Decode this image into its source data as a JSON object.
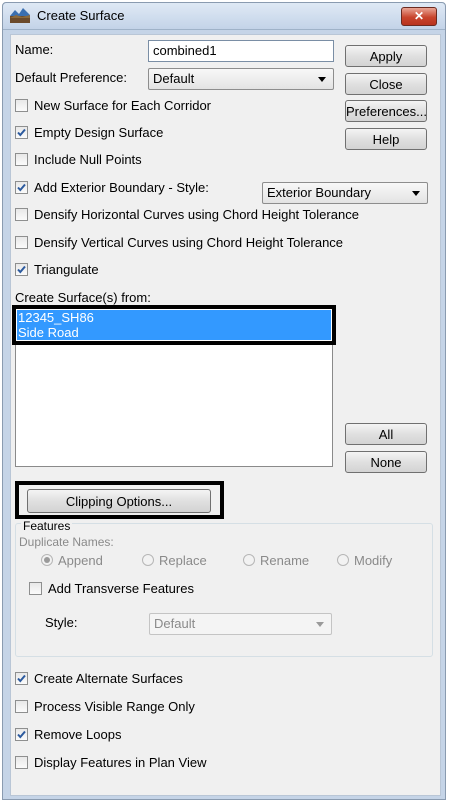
{
  "window": {
    "title": "Create Surface",
    "close_symbol": "✕"
  },
  "form": {
    "name_label": "Name:",
    "name_value": "combined1",
    "pref_label": "Default Preference:",
    "pref_value": "Default"
  },
  "buttons": {
    "apply": "Apply",
    "close": "Close",
    "preferences": "Preferences...",
    "help": "Help",
    "all": "All",
    "none": "None",
    "clipping": "Clipping Options..."
  },
  "options": {
    "new_surface": {
      "label": "New Surface for Each Corridor",
      "checked": false
    },
    "empty_design": {
      "label": "Empty Design Surface",
      "checked": true
    },
    "null_points": {
      "label": "Include Null Points",
      "checked": false
    },
    "exterior_boundary": {
      "label": "Add Exterior Boundary - Style:",
      "checked": true,
      "style_value": "Exterior Boundary"
    },
    "densify_horizontal": {
      "label": "Densify Horizontal Curves using Chord Height Tolerance",
      "checked": false
    },
    "densify_vertical": {
      "label": "Densify Vertical Curves using Chord Height Tolerance",
      "checked": false
    },
    "triangulate": {
      "label": "Triangulate",
      "checked": true
    }
  },
  "surfaces": {
    "label": "Create Surface(s) from:",
    "items": [
      "12345_SH86",
      "Side Road"
    ]
  },
  "features": {
    "group_label": "Features",
    "duplicate_label": "Duplicate Names:",
    "radios": [
      {
        "label": "Append",
        "selected": true
      },
      {
        "label": "Replace",
        "selected": false
      },
      {
        "label": "Rename",
        "selected": false
      },
      {
        "label": "Modify",
        "selected": false
      }
    ],
    "transverse": {
      "label": "Add Transverse Features",
      "checked": false
    },
    "style_label": "Style:",
    "style_value": "Default"
  },
  "bottom_options": {
    "alternate": {
      "label": "Create Alternate Surfaces",
      "checked": true
    },
    "visible_range": {
      "label": "Process Visible Range Only",
      "checked": false
    },
    "remove_loops": {
      "label": "Remove Loops",
      "checked": true
    },
    "plan_view": {
      "label": "Display Features in Plan View",
      "checked": false
    }
  },
  "colors": {
    "selection": "#3399ff",
    "titlebar": "#c3d3e8",
    "close_button": "#c8442c",
    "check": "#2c5a9e"
  },
  "icons": {
    "app": "surface-app-icon",
    "check": "checkmark-icon",
    "dropdown": "chevron-down-icon"
  }
}
